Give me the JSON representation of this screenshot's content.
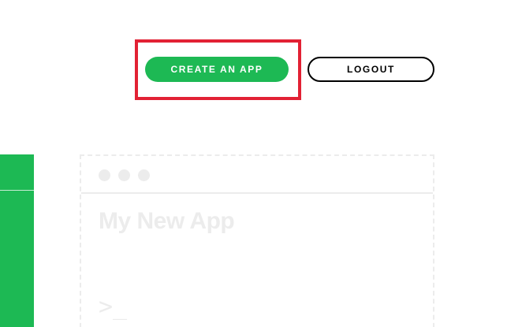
{
  "header": {
    "create_app_label": "CREATE AN APP",
    "logout_label": "LOGOUT"
  },
  "placeholder_card": {
    "title": "My New App",
    "prompt": ">_"
  },
  "colors": {
    "brand_green": "#1db954",
    "highlight_red": "#e22134",
    "placeholder_gray": "#ececec"
  }
}
